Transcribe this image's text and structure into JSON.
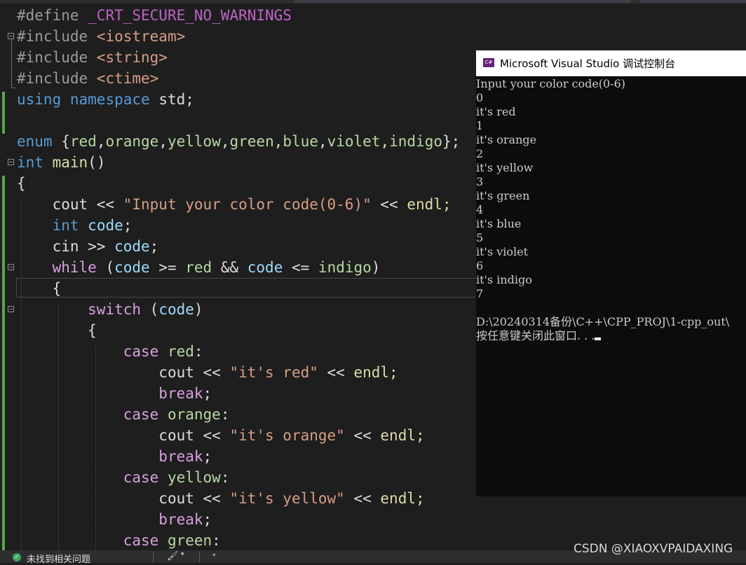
{
  "editor": {
    "line1": {
      "define": "#define ",
      "macro": "_CRT_SECURE_NO_WARNINGS"
    },
    "line2": {
      "include": "#include ",
      "header": "<iostream>"
    },
    "line3": {
      "include": "#include ",
      "header": "<string>"
    },
    "line4": {
      "include": "#include ",
      "header": "<ctime>"
    },
    "line5": {
      "using": "using",
      "namespace": "namespace",
      "std": "std;"
    },
    "line7": {
      "enum": "enum",
      "open": " {",
      "values": [
        "red",
        "orange",
        "yellow",
        "green",
        "blue",
        "violet",
        "indigo"
      ],
      "close": "};"
    },
    "line8": {
      "int": "int",
      "main": "main",
      "parens": "()"
    },
    "line9": {
      "brace": "{"
    },
    "line10": {
      "cout": "cout << ",
      "string": "\"Input your color code(0-6)\"",
      "ops": " << ",
      "endl": "endl;"
    },
    "line11": {
      "int": "int",
      "code": "code",
      "semi": ";"
    },
    "line12": {
      "cin": "cin >> ",
      "code": "code",
      "semi": ";"
    },
    "line13": {
      "while": "while",
      "open": " (",
      "code1": "code",
      "ge": " >= ",
      "red": "red",
      "and": " && ",
      "code2": "code",
      "le": " <= ",
      "indigo": "indigo",
      "close": ")"
    },
    "line14": {
      "brace": "{"
    },
    "line15": {
      "switch": "switch",
      "open": " (",
      "code": "code",
      "close": ")"
    },
    "line16": {
      "brace": "{"
    },
    "cases": [
      {
        "case": "case",
        "label": "red",
        "colon": ":",
        "cout": "cout << ",
        "string": "\"it's red\"",
        "ops": " << ",
        "endl": "endl;",
        "brk": "break",
        "semi": ";"
      },
      {
        "case": "case",
        "label": "orange",
        "colon": ":",
        "cout": "cout << ",
        "string": "\"it's orange\"",
        "ops": " << ",
        "endl": "endl;",
        "brk": "break",
        "semi": ";"
      },
      {
        "case": "case",
        "label": "yellow",
        "colon": ":",
        "cout": "cout << ",
        "string": "\"it's yellow\"",
        "ops": " << ",
        "endl": "endl;",
        "brk": "break",
        "semi": ";"
      },
      {
        "case": "case",
        "label": "green",
        "colon": ":"
      }
    ]
  },
  "console": {
    "title": "Microsoft Visual Studio 调试控制台",
    "icon_label": "C#",
    "lines": [
      "Input your color code(0-6)",
      "0",
      "it's red",
      "1",
      "it's orange",
      "2",
      "it's yellow",
      "3",
      "it's green",
      "4",
      "it's blue",
      "5",
      "it's violet",
      "6",
      "it's indigo",
      "7",
      "",
      "D:\\20240314备份\\C++\\CPP_PROJ\\1-cpp_out\\",
      "按任意键关闭此窗口. . ."
    ]
  },
  "statusbar": {
    "status_text": "未找到相关问题",
    "status_icon": "check-circle-icon",
    "brush_icon": "brush-icon"
  },
  "watermark": "CSDN @XIAOXVPAIDAXING",
  "colors": {
    "background": "#1e1e1e",
    "keyword": "#569cd6",
    "control": "#d8a0df",
    "string": "#d69d85",
    "variable": "#9cdcfe",
    "enum_member": "#b8d7a3",
    "function": "#dcdcaa",
    "change_bar": "#57a64a",
    "console_bg": "#0c0c0c"
  }
}
